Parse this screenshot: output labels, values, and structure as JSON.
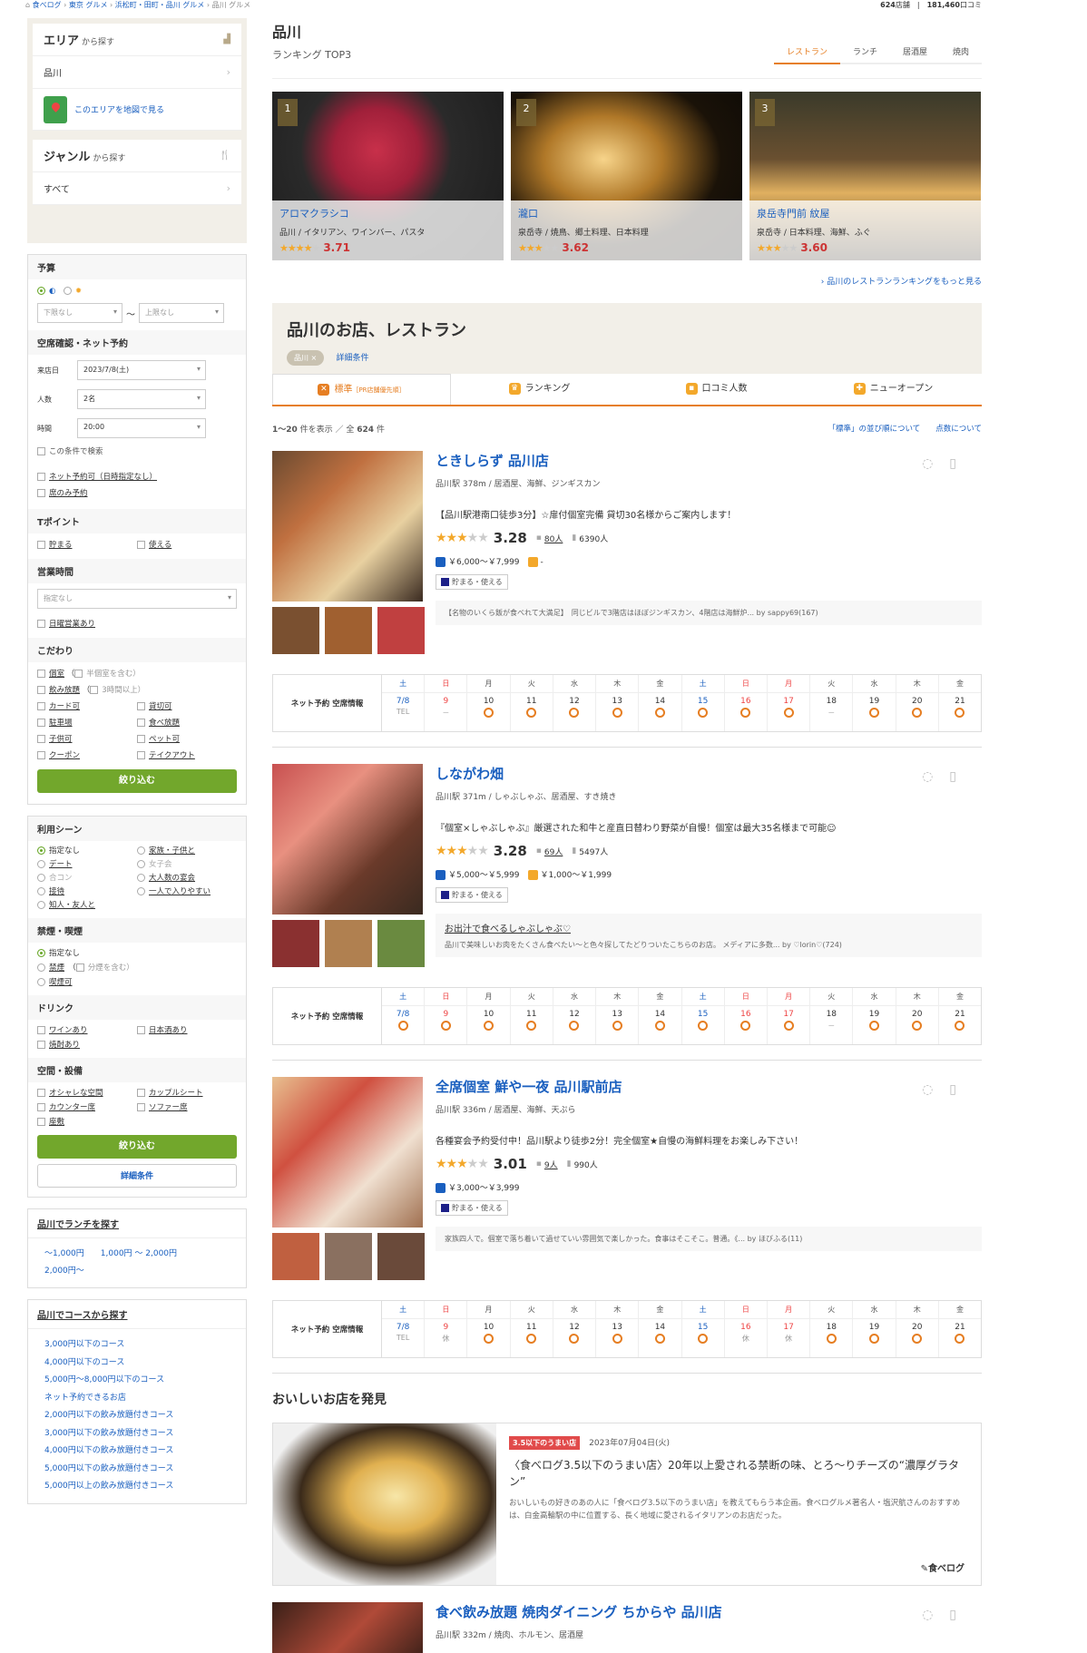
{
  "breadcrumb": [
    "食べログ",
    "東京 グルメ",
    "浜松町・田町・品川 グルメ",
    "品川 グルメ",
    "品川 グルメ"
  ],
  "counts": {
    "shops": "624",
    "shops_unit": "店舗",
    "reviews": "181,460",
    "reviews_unit": "口コミ"
  },
  "sidebar": {
    "area_heading": "エリア",
    "area_suffix": "から探す",
    "area_item": "品川",
    "map_link": "このエリアを地図で見る",
    "genre_heading": "ジャンル",
    "genre_suffix": "から探す",
    "genre_item": "すべて",
    "budget_label": "予算",
    "budget_min": "下限なし",
    "budget_max": "上限なし",
    "budget_sep": "〜",
    "reserve_label": "空席確認・ネット予約",
    "date_label": "来店日",
    "date_value": "2023/7/8(土)",
    "people_label": "人数",
    "people_value": "2名",
    "time_label": "時間",
    "time_value": "20:00",
    "search_cond": "この条件で検索",
    "net_reserve": "ネット予約可（日時指定なし）",
    "seat_only": "席のみ予約",
    "tpoint_label": "Tポイント",
    "tpoint_earn": "貯まる",
    "tpoint_use": "使える",
    "hours_label": "営業時間",
    "hours_value": "指定なし",
    "sunday_open": "日曜営業あり",
    "kodawari_label": "こだわり",
    "kodawari_items": [
      "個室",
      "（",
      "半個室を含む）",
      "飲み放題",
      "（",
      "3時間以上）",
      "カード可",
      "貸切可",
      "駐車場",
      "食べ放題",
      "子供可",
      "ペット可",
      "クーポン",
      "テイクアウト"
    ],
    "narrow": "絞り込む",
    "scene_label": "利用シーン",
    "scene_items": [
      "指定なし",
      "家族・子供と",
      "デート",
      "女子会",
      "合コン",
      "大人数の宴会",
      "接待",
      "一人で入りやすい",
      "知人・友人と"
    ],
    "smoke_label": "禁煙・喫煙",
    "smoke_items": [
      "指定なし",
      "禁煙",
      "（",
      "分煙を含む）",
      "喫煙可"
    ],
    "drink_label": "ドリンク",
    "drink_items": [
      "ワインあり",
      "日本酒あり",
      "焼酎あり"
    ],
    "space_label": "空間・設備",
    "space_items": [
      "オシャレな空間",
      "カップルシート",
      "カウンター席",
      "ソファー席",
      "座敷"
    ],
    "narrow2": "絞り込む",
    "detail": "詳細条件",
    "lunch_heading": "品川でランチを探す",
    "lunch_items": [
      "〜1,000円",
      "1,000円 〜 2,000円",
      "2,000円〜"
    ],
    "course_heading": "品川でコースから探す",
    "course_items": [
      "3,000円以下のコース",
      "4,000円以下のコース",
      "5,000円〜8,000円以下のコース",
      "ネット予約できるお店",
      "2,000円以下の飲み放題付きコース",
      "3,000円以下の飲み放題付きコース",
      "4,000円以下の飲み放題付きコース",
      "5,000円以下の飲み放題付きコース",
      "5,000円以上の飲み放題付きコース"
    ]
  },
  "main": {
    "title": "品川",
    "subtitle": "ランキング TOP3",
    "rank_tabs": [
      "レストラン",
      "ランチ",
      "居酒屋",
      "焼肉"
    ],
    "top3": [
      {
        "rank": "1",
        "name": "アロマクラシコ",
        "genre": "品川 / イタリアン、ワインバー、パスタ",
        "score": "3.71",
        "stars": "★★★★",
        "star_off": "★"
      },
      {
        "rank": "2",
        "name": "瀧口",
        "genre": "泉岳寺 / 焼鳥、郷土料理、日本料理",
        "score": "3.62",
        "stars": "★★★",
        "star_off": "★★"
      },
      {
        "rank": "3",
        "name": "泉岳寺門前 紋屋",
        "genre": "泉岳寺 / 日本料理、海鮮、ふぐ",
        "score": "3.60",
        "stars": "★★★",
        "star_off": "★★"
      }
    ],
    "more_ranking": "品川のレストランランキングをもっと見る",
    "shop_heading": "品川のお店、レストラン",
    "tag": "品川 ×",
    "detail_cond": "詳細条件",
    "sort_tabs": [
      "標準",
      "ランキング",
      "口コミ人数",
      "ニューオープン"
    ],
    "sort_sub": "［PR店舗優先順］",
    "count_range": "1〜20",
    "count_mid": "件を表示 ／ 全",
    "count_total": "624",
    "count_unit": "件",
    "order_link": "「標準」の並び順について",
    "points_link": "点数について",
    "cal_label": "ネット予約 空席情報",
    "cal_dows": [
      "土",
      "日",
      "月",
      "火",
      "水",
      "木",
      "金",
      "土",
      "日",
      "月",
      "火",
      "水",
      "木",
      "金"
    ],
    "cal_days": [
      "7/8",
      "9",
      "10",
      "11",
      "12",
      "13",
      "14",
      "15",
      "16",
      "17",
      "18",
      "19",
      "20",
      "21"
    ],
    "restaurants": [
      {
        "name": "ときしらず 品川店",
        "genre": "品川駅 378m / 居酒屋、海鮮、ジンギスカン",
        "pr": "【品川駅港南口徒歩3分】☆扉付個室完備 貸切30名様からご案内します！",
        "score": "3.28",
        "stars": "★★★",
        "star_off": "★★",
        "reviews": "80人",
        "saves": "6390人",
        "night": "￥6,000〜￥7,999",
        "lunch": "-",
        "tpoint": "貯まる・使える",
        "rev_title": "",
        "rev_text": "【名物のいくら飯が食べれて大満足】　同じビルで3階店はほぼジンギスカン、4階店は海鮮炉... by sappy69(167)",
        "cal_status": [
          "TEL",
          "－",
          "o",
          "o",
          "o",
          "o",
          "o",
          "o",
          "o",
          "o",
          "－",
          "o",
          "o",
          "o"
        ]
      },
      {
        "name": "しながわ畑",
        "genre": "品川駅 371m / しゃぶしゃぶ、居酒屋、すき焼き",
        "pr": "『個室×しゃぶしゃぶ』厳選された和牛と産直日替わり野菜が自慢！個室は最大35名様まで可能☺",
        "score": "3.28",
        "stars": "★★★",
        "star_off": "★★",
        "reviews": "69人",
        "saves": "5497人",
        "night": "￥5,000〜￥5,999",
        "lunch": "￥1,000〜￥1,999",
        "tpoint": "貯まる・使える",
        "rev_title": "お出汁で食べるしゃぶしゃぶ♡",
        "rev_text": "品川で美味しいお肉をたくさん食べたい〜と色々探してたどりついたこちらのお店。 メディアに多数... by ♡lorin♡(724)",
        "cal_status": [
          "o",
          "o",
          "o",
          "o",
          "o",
          "o",
          "o",
          "o",
          "o",
          "o",
          "－",
          "o",
          "o",
          "o"
        ]
      },
      {
        "name": "全席個室 鮮や一夜 品川駅前店",
        "genre": "品川駅 336m / 居酒屋、海鮮、天ぷら",
        "pr": "各種宴会予約受付中！品川駅より徒歩2分！完全個室★自慢の海鮮料理をお楽しみ下さい！",
        "score": "3.01",
        "stars": "★★★",
        "star_off": "★★",
        "reviews": "9人",
        "saves": "990人",
        "night": "￥3,000〜￥3,999",
        "lunch": "",
        "tpoint": "貯まる・使える",
        "rev_title": "",
        "rev_text": "家族四人で。個室で落ち着いて過せていい雰囲気で楽しかった。食事はそこそこ。普通。《... by ほびふる(11)",
        "cal_status": [
          "TEL",
          "休",
          "o",
          "o",
          "o",
          "o",
          "o",
          "o",
          "休",
          "休",
          "o",
          "o",
          "o",
          "o"
        ]
      }
    ],
    "discover_heading": "おいしいお店を発見",
    "article": {
      "badge": "3.5以下のうまい店",
      "date": "2023年07月04日(火)",
      "title": "〈食べログ3.5以下のうまい店〉20年以上愛される禁断の味、とろ〜りチーズの“濃厚グラタン”",
      "body": "おいしいもの好きのあの人に「食べログ3.5以下のうまい店」を教えてもらう本企画。食べログルメ著名人・塩沢航さんのおすすめは、白金高輪駅の中に位置する、長く地域に愛されるイタリアンのお店だった。",
      "logo": "食べログ"
    },
    "next": {
      "name": "食べ飲み放題 焼肉ダイニング ちからや 品川店",
      "genre": "品川駅 332m / 焼肉、ホルモン、居酒屋"
    }
  }
}
